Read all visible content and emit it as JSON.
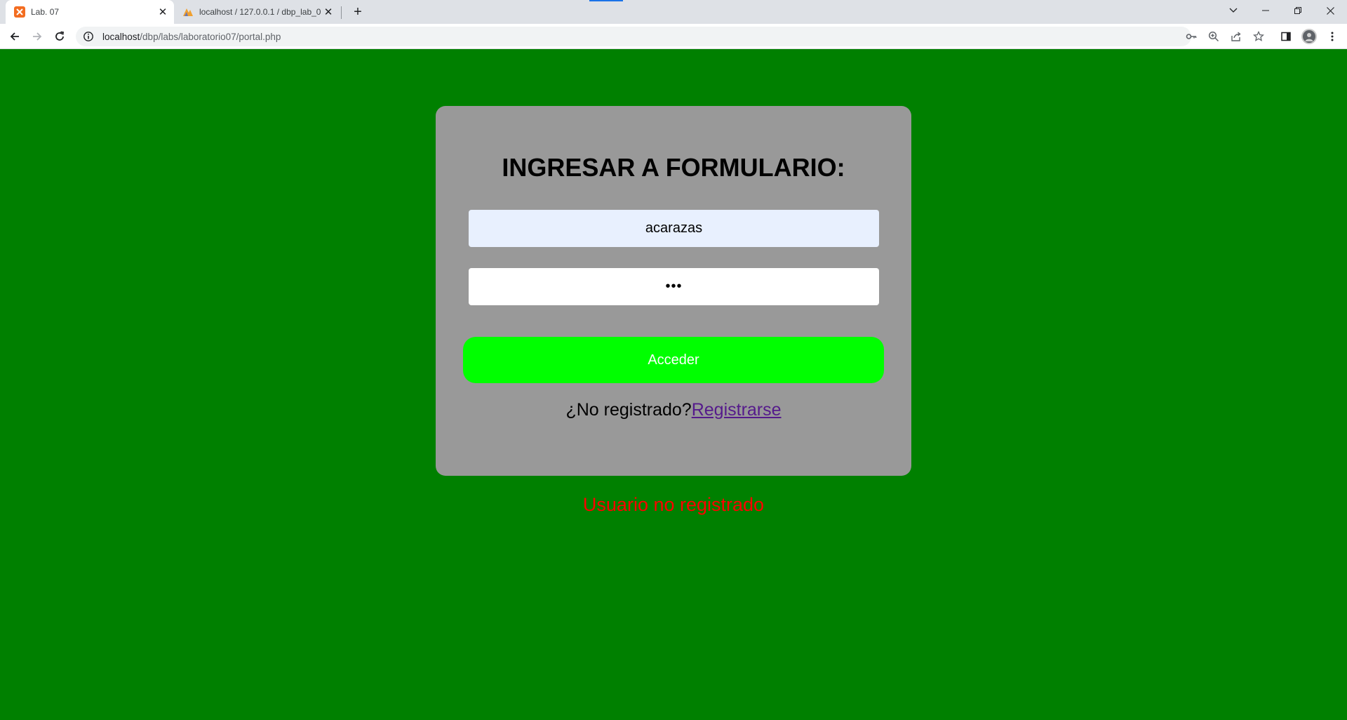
{
  "browser": {
    "tabs": [
      {
        "title": "Lab. 07",
        "active": true,
        "favicon": "xampp-icon"
      },
      {
        "title": "localhost / 127.0.0.1 / dbp_lab_0(",
        "active": false,
        "favicon": "phpmyadmin-icon"
      }
    ],
    "address": {
      "host": "localhost",
      "path": "/dbp/labs/laboratorio07/portal.php"
    }
  },
  "form": {
    "title": "INGRESAR A FORMULARIO:",
    "username_value": "acarazas",
    "password_value": "•••",
    "submit_label": "Acceder",
    "register_prompt": "¿No registrado?",
    "register_link": "Registrarse"
  },
  "status": {
    "error_message": "Usuario no registrado"
  },
  "colors": {
    "page_background": "#008000",
    "card_background": "#999999",
    "submit_button": "#00ff00",
    "error_text": "#ff0000",
    "link": "#551a8b"
  }
}
